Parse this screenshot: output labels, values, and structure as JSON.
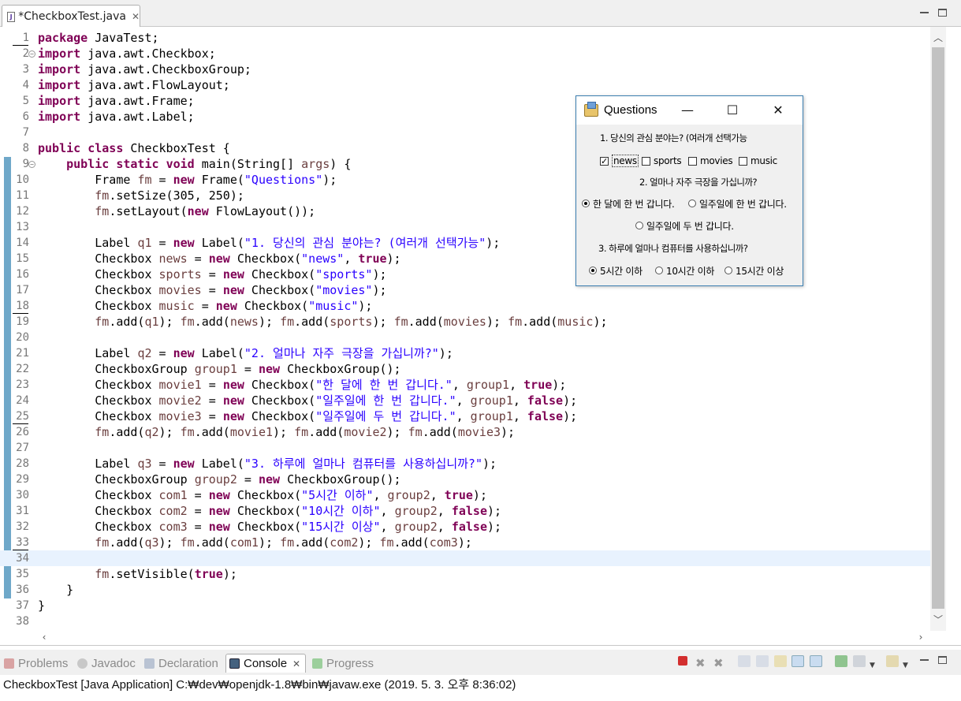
{
  "editor_tab": {
    "label": "*CheckboxTest.java",
    "close": "✕"
  },
  "code_lines": [
    {
      "n": "1",
      "parts": [
        [
          "k",
          "package"
        ],
        [
          "p",
          " JavaTest;"
        ]
      ]
    },
    {
      "n": "2",
      "fold": true,
      "parts": [
        [
          "k",
          "import"
        ],
        [
          "p",
          " java.awt.Checkbox;"
        ]
      ]
    },
    {
      "n": "3",
      "parts": [
        [
          "k",
          "import"
        ],
        [
          "p",
          " java.awt.CheckboxGroup;"
        ]
      ]
    },
    {
      "n": "4",
      "parts": [
        [
          "k",
          "import"
        ],
        [
          "p",
          " java.awt.FlowLayout;"
        ]
      ]
    },
    {
      "n": "5",
      "parts": [
        [
          "k",
          "import"
        ],
        [
          "p",
          " java.awt.Frame;"
        ]
      ]
    },
    {
      "n": "6",
      "parts": [
        [
          "k",
          "import"
        ],
        [
          "p",
          " java.awt.Label;"
        ]
      ]
    },
    {
      "n": "7",
      "parts": []
    },
    {
      "n": "8",
      "parts": [
        [
          "k",
          "public"
        ],
        [
          "p",
          " "
        ],
        [
          "k",
          "class"
        ],
        [
          "p",
          " CheckboxTest {"
        ]
      ]
    },
    {
      "n": "9",
      "fold": true,
      "parts": [
        [
          "p",
          "    "
        ],
        [
          "k",
          "public"
        ],
        [
          "p",
          " "
        ],
        [
          "k",
          "static"
        ],
        [
          "p",
          " "
        ],
        [
          "k",
          "void"
        ],
        [
          "p",
          " main(String[] "
        ],
        [
          "v",
          "args"
        ],
        [
          "p",
          ") {"
        ]
      ]
    },
    {
      "n": "10",
      "parts": [
        [
          "p",
          "        Frame "
        ],
        [
          "v",
          "fm"
        ],
        [
          "p",
          " = "
        ],
        [
          "k",
          "new"
        ],
        [
          "p",
          " Frame("
        ],
        [
          "s",
          "\"Questions\""
        ],
        [
          "p",
          ");"
        ]
      ]
    },
    {
      "n": "11",
      "parts": [
        [
          "p",
          "        "
        ],
        [
          "v",
          "fm"
        ],
        [
          "p",
          ".setSize(305, 250);"
        ]
      ]
    },
    {
      "n": "12",
      "parts": [
        [
          "p",
          "        "
        ],
        [
          "v",
          "fm"
        ],
        [
          "p",
          ".setLayout("
        ],
        [
          "k",
          "new"
        ],
        [
          "p",
          " FlowLayout());"
        ]
      ]
    },
    {
      "n": "13",
      "parts": []
    },
    {
      "n": "14",
      "parts": [
        [
          "p",
          "        Label "
        ],
        [
          "v",
          "q1"
        ],
        [
          "p",
          " = "
        ],
        [
          "k",
          "new"
        ],
        [
          "p",
          " Label("
        ],
        [
          "s",
          "\"1. 당신의 관심 분야는? (여러개 선택가능\""
        ],
        [
          "p",
          ");"
        ]
      ]
    },
    {
      "n": "15",
      "parts": [
        [
          "p",
          "        Checkbox "
        ],
        [
          "v",
          "news"
        ],
        [
          "p",
          " = "
        ],
        [
          "k",
          "new"
        ],
        [
          "p",
          " Checkbox("
        ],
        [
          "s",
          "\"news\""
        ],
        [
          "p",
          ", "
        ],
        [
          "k",
          "true"
        ],
        [
          "p",
          ");"
        ]
      ]
    },
    {
      "n": "16",
      "parts": [
        [
          "p",
          "        Checkbox "
        ],
        [
          "v",
          "sports"
        ],
        [
          "p",
          " = "
        ],
        [
          "k",
          "new"
        ],
        [
          "p",
          " Checkbox("
        ],
        [
          "s",
          "\"sports\""
        ],
        [
          "p",
          ");"
        ]
      ]
    },
    {
      "n": "17",
      "parts": [
        [
          "p",
          "        Checkbox "
        ],
        [
          "v",
          "movies"
        ],
        [
          "p",
          " = "
        ],
        [
          "k",
          "new"
        ],
        [
          "p",
          " Checkbox("
        ],
        [
          "s",
          "\"movies\""
        ],
        [
          "p",
          ");"
        ]
      ]
    },
    {
      "n": "18",
      "parts": [
        [
          "p",
          "        Checkbox "
        ],
        [
          "v",
          "music"
        ],
        [
          "p",
          " = "
        ],
        [
          "k",
          "new"
        ],
        [
          "p",
          " Checkbox("
        ],
        [
          "s",
          "\"music\""
        ],
        [
          "p",
          ");"
        ]
      ]
    },
    {
      "n": "19",
      "parts": [
        [
          "p",
          "        "
        ],
        [
          "v",
          "fm"
        ],
        [
          "p",
          ".add("
        ],
        [
          "v",
          "q1"
        ],
        [
          "p",
          "); "
        ],
        [
          "v",
          "fm"
        ],
        [
          "p",
          ".add("
        ],
        [
          "v",
          "news"
        ],
        [
          "p",
          "); "
        ],
        [
          "v",
          "fm"
        ],
        [
          "p",
          ".add("
        ],
        [
          "v",
          "sports"
        ],
        [
          "p",
          "); "
        ],
        [
          "v",
          "fm"
        ],
        [
          "p",
          ".add("
        ],
        [
          "v",
          "movies"
        ],
        [
          "p",
          "); "
        ],
        [
          "v",
          "fm"
        ],
        [
          "p",
          ".add("
        ],
        [
          "v",
          "music"
        ],
        [
          "p",
          ");"
        ]
      ]
    },
    {
      "n": "20",
      "parts": []
    },
    {
      "n": "21",
      "parts": [
        [
          "p",
          "        Label "
        ],
        [
          "v",
          "q2"
        ],
        [
          "p",
          " = "
        ],
        [
          "k",
          "new"
        ],
        [
          "p",
          " Label("
        ],
        [
          "s",
          "\"2. 얼마나 자주 극장을 가십니까?\""
        ],
        [
          "p",
          ");"
        ]
      ]
    },
    {
      "n": "22",
      "parts": [
        [
          "p",
          "        CheckboxGroup "
        ],
        [
          "v",
          "group1"
        ],
        [
          "p",
          " = "
        ],
        [
          "k",
          "new"
        ],
        [
          "p",
          " CheckboxGroup();"
        ]
      ]
    },
    {
      "n": "23",
      "parts": [
        [
          "p",
          "        Checkbox "
        ],
        [
          "v",
          "movie1"
        ],
        [
          "p",
          " = "
        ],
        [
          "k",
          "new"
        ],
        [
          "p",
          " Checkbox("
        ],
        [
          "s",
          "\"한 달에 한 번 갑니다.\""
        ],
        [
          "p",
          ", "
        ],
        [
          "v",
          "group1"
        ],
        [
          "p",
          ", "
        ],
        [
          "k",
          "true"
        ],
        [
          "p",
          ");"
        ]
      ]
    },
    {
      "n": "24",
      "parts": [
        [
          "p",
          "        Checkbox "
        ],
        [
          "v",
          "movie2"
        ],
        [
          "p",
          " = "
        ],
        [
          "k",
          "new"
        ],
        [
          "p",
          " Checkbox("
        ],
        [
          "s",
          "\"일주일에 한 번 갑니다.\""
        ],
        [
          "p",
          ", "
        ],
        [
          "v",
          "group1"
        ],
        [
          "p",
          ", "
        ],
        [
          "k",
          "false"
        ],
        [
          "p",
          ");"
        ]
      ]
    },
    {
      "n": "25",
      "parts": [
        [
          "p",
          "        Checkbox "
        ],
        [
          "v",
          "movie3"
        ],
        [
          "p",
          " = "
        ],
        [
          "k",
          "new"
        ],
        [
          "p",
          " Checkbox("
        ],
        [
          "s",
          "\"일주일에 두 번 갑니다.\""
        ],
        [
          "p",
          ", "
        ],
        [
          "v",
          "group1"
        ],
        [
          "p",
          ", "
        ],
        [
          "k",
          "false"
        ],
        [
          "p",
          ");"
        ]
      ]
    },
    {
      "n": "26",
      "parts": [
        [
          "p",
          "        "
        ],
        [
          "v",
          "fm"
        ],
        [
          "p",
          ".add("
        ],
        [
          "v",
          "q2"
        ],
        [
          "p",
          "); "
        ],
        [
          "v",
          "fm"
        ],
        [
          "p",
          ".add("
        ],
        [
          "v",
          "movie1"
        ],
        [
          "p",
          "); "
        ],
        [
          "v",
          "fm"
        ],
        [
          "p",
          ".add("
        ],
        [
          "v",
          "movie2"
        ],
        [
          "p",
          "); "
        ],
        [
          "v",
          "fm"
        ],
        [
          "p",
          ".add("
        ],
        [
          "v",
          "movie3"
        ],
        [
          "p",
          ");"
        ]
      ]
    },
    {
      "n": "27",
      "parts": []
    },
    {
      "n": "28",
      "parts": [
        [
          "p",
          "        Label "
        ],
        [
          "v",
          "q3"
        ],
        [
          "p",
          " = "
        ],
        [
          "k",
          "new"
        ],
        [
          "p",
          " Label("
        ],
        [
          "s",
          "\"3. 하루에 얼마나 컴퓨터를 사용하십니까?\""
        ],
        [
          "p",
          ");"
        ]
      ]
    },
    {
      "n": "29",
      "parts": [
        [
          "p",
          "        CheckboxGroup "
        ],
        [
          "v",
          "group2"
        ],
        [
          "p",
          " = "
        ],
        [
          "k",
          "new"
        ],
        [
          "p",
          " CheckboxGroup();"
        ]
      ]
    },
    {
      "n": "30",
      "parts": [
        [
          "p",
          "        Checkbox "
        ],
        [
          "v",
          "com1"
        ],
        [
          "p",
          " = "
        ],
        [
          "k",
          "new"
        ],
        [
          "p",
          " Checkbox("
        ],
        [
          "s",
          "\"5시간 이하\""
        ],
        [
          "p",
          ", "
        ],
        [
          "v",
          "group2"
        ],
        [
          "p",
          ", "
        ],
        [
          "k",
          "true"
        ],
        [
          "p",
          ");"
        ]
      ]
    },
    {
      "n": "31",
      "parts": [
        [
          "p",
          "        Checkbox "
        ],
        [
          "v",
          "com2"
        ],
        [
          "p",
          " = "
        ],
        [
          "k",
          "new"
        ],
        [
          "p",
          " Checkbox("
        ],
        [
          "s",
          "\"10시간 이하\""
        ],
        [
          "p",
          ", "
        ],
        [
          "v",
          "group2"
        ],
        [
          "p",
          ", "
        ],
        [
          "k",
          "false"
        ],
        [
          "p",
          ");"
        ]
      ]
    },
    {
      "n": "32",
      "parts": [
        [
          "p",
          "        Checkbox "
        ],
        [
          "v",
          "com3"
        ],
        [
          "p",
          " = "
        ],
        [
          "k",
          "new"
        ],
        [
          "p",
          " Checkbox("
        ],
        [
          "s",
          "\"15시간 이상\""
        ],
        [
          "p",
          ", "
        ],
        [
          "v",
          "group2"
        ],
        [
          "p",
          ", "
        ],
        [
          "k",
          "false"
        ],
        [
          "p",
          ");"
        ]
      ]
    },
    {
      "n": "33",
      "parts": [
        [
          "p",
          "        "
        ],
        [
          "v",
          "fm"
        ],
        [
          "p",
          ".add("
        ],
        [
          "v",
          "q3"
        ],
        [
          "p",
          "); "
        ],
        [
          "v",
          "fm"
        ],
        [
          "p",
          ".add("
        ],
        [
          "v",
          "com1"
        ],
        [
          "p",
          "); "
        ],
        [
          "v",
          "fm"
        ],
        [
          "p",
          ".add("
        ],
        [
          "v",
          "com2"
        ],
        [
          "p",
          "); "
        ],
        [
          "v",
          "fm"
        ],
        [
          "p",
          ".add("
        ],
        [
          "v",
          "com3"
        ],
        [
          "p",
          ");"
        ]
      ]
    },
    {
      "n": "34",
      "current": true,
      "parts": []
    },
    {
      "n": "35",
      "parts": [
        [
          "p",
          "        "
        ],
        [
          "v",
          "fm"
        ],
        [
          "p",
          ".setVisible("
        ],
        [
          "k",
          "true"
        ],
        [
          "p",
          ");"
        ]
      ]
    },
    {
      "n": "36",
      "parts": [
        [
          "p",
          "    }"
        ]
      ]
    },
    {
      "n": "37",
      "parts": [
        [
          "p",
          "}"
        ]
      ]
    },
    {
      "n": "38",
      "parts": []
    }
  ],
  "awt_window": {
    "title": "Questions",
    "q1": "1. 당신의 관심 분야는? (여러개 선택가능",
    "checkboxes": [
      {
        "label": "news",
        "checked": true
      },
      {
        "label": "sports",
        "checked": false
      },
      {
        "label": "movies",
        "checked": false
      },
      {
        "label": "music",
        "checked": false
      }
    ],
    "q2": "2. 얼마나 자주 극장을 가십니까?",
    "movie_options": [
      {
        "label": "한 달에 한 번 갑니다.",
        "selected": true
      },
      {
        "label": "일주일에 한 번 갑니다.",
        "selected": false
      },
      {
        "label": "일주일에 두 번 갑니다.",
        "selected": false
      }
    ],
    "q3": "3. 하루에 얼마나 컴퓨터를 사용하십니까?",
    "com_options": [
      {
        "label": "5시간 이하",
        "selected": true
      },
      {
        "label": "10시간 이하",
        "selected": false
      },
      {
        "label": "15시간 이상",
        "selected": false
      }
    ]
  },
  "panel": {
    "tabs": [
      {
        "label": "Problems",
        "icon": "problems-icon",
        "active": false
      },
      {
        "label": "Javadoc",
        "icon": "javadoc-icon",
        "active": false
      },
      {
        "label": "Declaration",
        "icon": "declaration-icon",
        "active": false
      },
      {
        "label": "Console",
        "icon": "console-icon",
        "active": true
      },
      {
        "label": "Progress",
        "icon": "progress-icon",
        "active": false
      }
    ],
    "console_text": "CheckboxTest [Java Application] C:₩dev₩openjdk-1.8₩bin₩javaw.exe (2019. 5. 3. 오후 8:36:02)"
  },
  "colors": {
    "keyword": "#7f0055",
    "string": "#2a00ff",
    "variable": "#6a3e3e",
    "current_line": "#e8f2fe",
    "change_bar": "#6fa8c9"
  }
}
